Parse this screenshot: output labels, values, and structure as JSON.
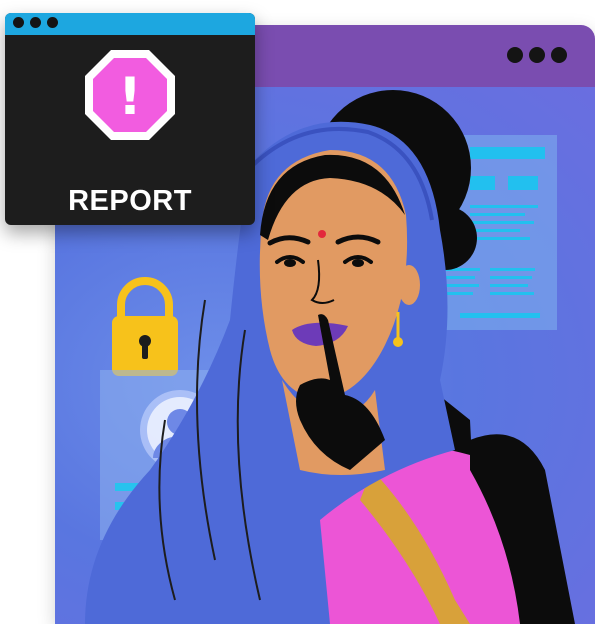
{
  "report_card": {
    "label": "REPORT",
    "warning_glyph": "!",
    "icon": "warning-octagon-icon"
  },
  "colors": {
    "browser_titlebar": "#7a4db0",
    "browser_background": "#5b7ae3",
    "report_titlebar": "#1da7e0",
    "report_card": "#1d1d1d",
    "warning_fill": "#f25ce0",
    "lock": "#f7c21b",
    "saree": "#ec55d6",
    "veil": "#4e6ad8"
  },
  "icons": [
    "lock-icon",
    "user-avatar-icon",
    "warning-octagon-icon"
  ]
}
